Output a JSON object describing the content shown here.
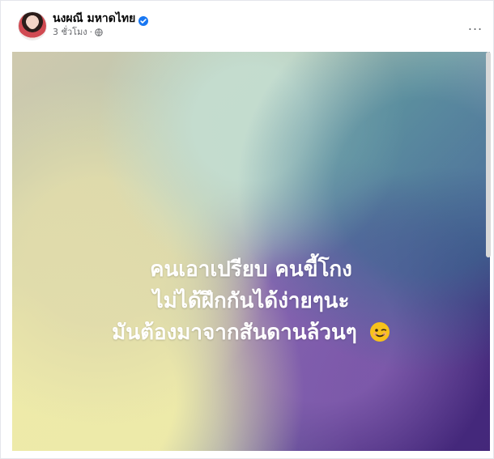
{
  "post": {
    "author_name": "นงผณี มหาดไทย",
    "timestamp": "3 ชั่วโมง",
    "separator": "·",
    "more_label": "..."
  },
  "icons": {
    "verified": "verified-badge-icon",
    "audience": "globe-icon",
    "emoji": "winking-face-icon"
  },
  "content": {
    "lines": [
      "คนเอาเปรียบ คนขี้โกง",
      "ไม่ได้ฝึกกันได้ง่ายๆนะ",
      "มันต้องมาจากสันดานล้วนๆ"
    ]
  },
  "colors": {
    "verified_blue": "#1877f2",
    "secondary_text": "#65676b",
    "primary_text": "#050505"
  }
}
